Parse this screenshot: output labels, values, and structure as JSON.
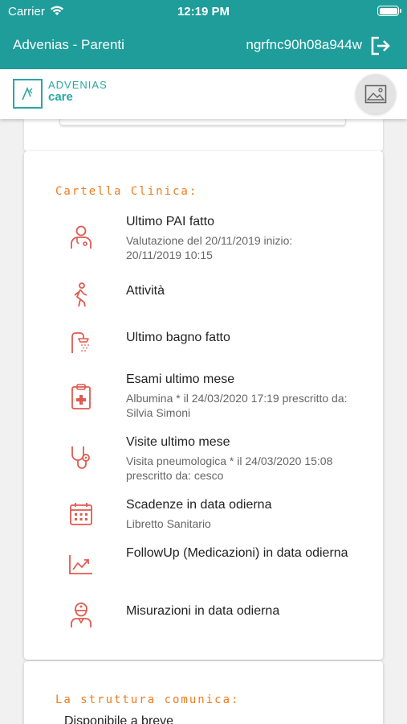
{
  "status_bar": {
    "carrier": "Carrier",
    "time": "12:19 PM"
  },
  "header": {
    "title": "Advenias - Parenti",
    "user_code": "ngrfnc90h08a944w"
  },
  "logo": {
    "brand": "ADVENIAS",
    "product": "care"
  },
  "clinical_record": {
    "section_title": "Cartella Clinica:",
    "items": [
      {
        "icon": "doctor-icon",
        "title": "Ultimo PAI fatto",
        "subtitle": "Valutazione del 20/11/2019 inizio: 20/11/2019 10:15"
      },
      {
        "icon": "walking-person-icon",
        "title": "Attività",
        "subtitle": ""
      },
      {
        "icon": "shower-icon",
        "title": "Ultimo bagno fatto",
        "subtitle": ""
      },
      {
        "icon": "medical-clipboard-icon",
        "title": "Esami ultimo mese",
        "subtitle": "Albumina * il 24/03/2020 17:19 prescritto da: Silvia Simoni"
      },
      {
        "icon": "stethoscope-icon",
        "title": "Visite ultimo mese",
        "subtitle": "Visita pneumologica * il 24/03/2020 15:08 prescritto da: cesco"
      },
      {
        "icon": "calendar-icon",
        "title": "Scadenze in data odierna",
        "subtitle": "Libretto Sanitario"
      },
      {
        "icon": "trend-chart-icon",
        "title": "FollowUp (Medicazioni) in data odierna",
        "subtitle": ""
      },
      {
        "icon": "nurse-icon",
        "title": "Misurazioni in data odierna",
        "subtitle": ""
      }
    ]
  },
  "structure_communications": {
    "section_title": "La struttura comunica:",
    "message": "Disponibile a breve"
  },
  "colors": {
    "brand_teal": "#1f9d9a",
    "accent_orange": "#f07c1f",
    "icon_red": "#e05a4f"
  }
}
